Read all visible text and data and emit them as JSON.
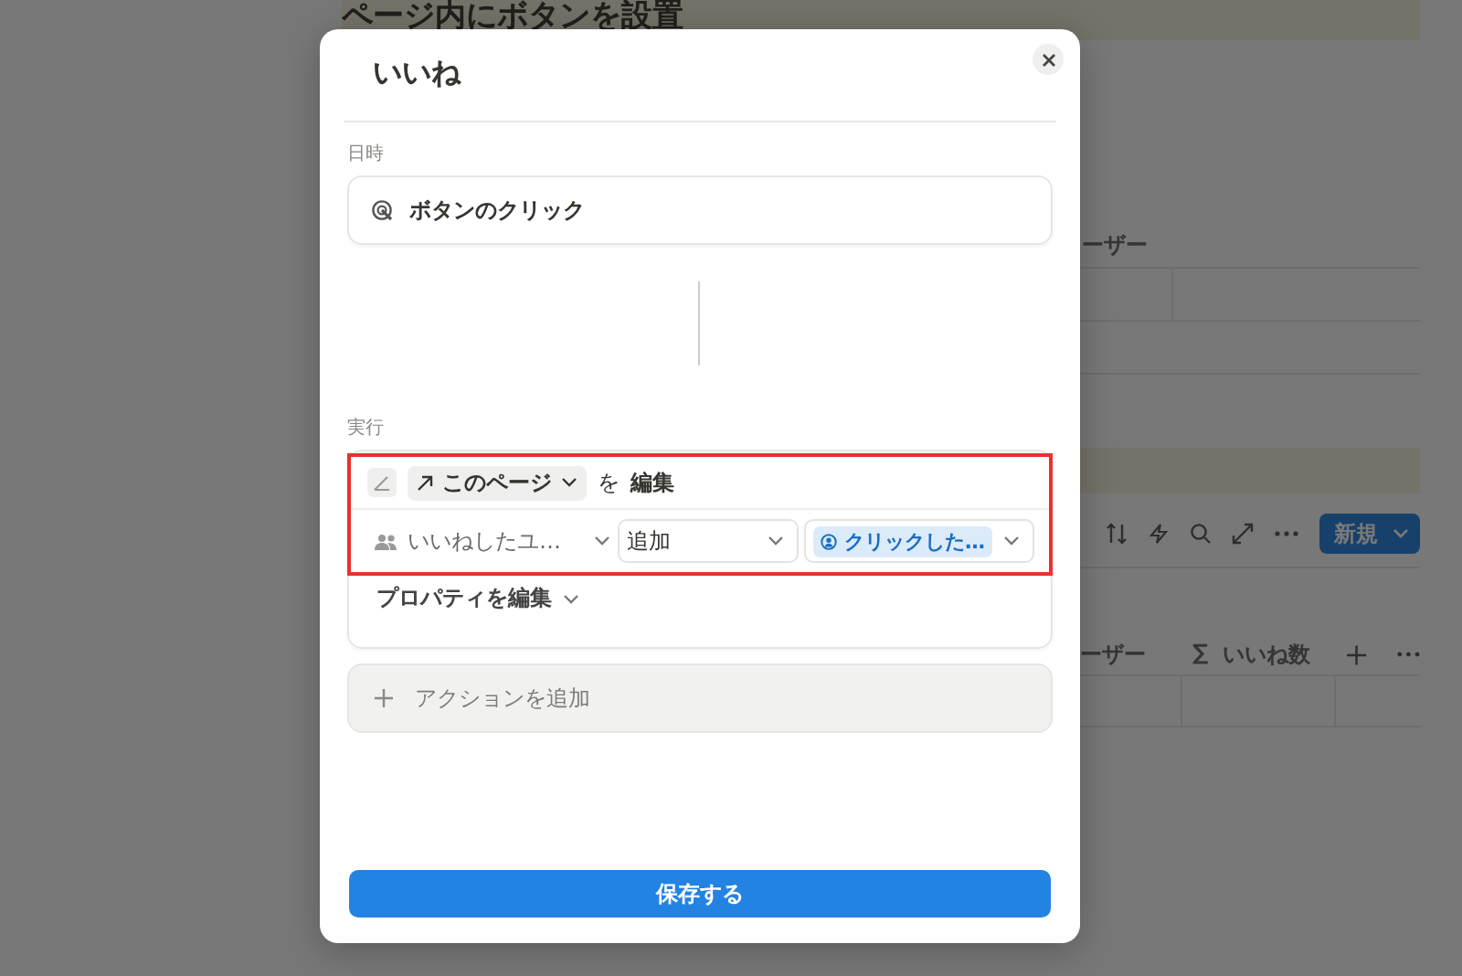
{
  "background_page": {
    "heading": "ページ内にボタンを設置",
    "table_1": {
      "column_header": "ーザー"
    },
    "toolbar": {
      "new_button": "新規"
    },
    "table_2": {
      "columns": [
        {
          "kind": "text",
          "label": "ーザー"
        },
        {
          "kind": "sum",
          "symbol": "∑",
          "label": "いいね数"
        }
      ]
    }
  },
  "dialog": {
    "title": "いいね",
    "trigger": {
      "label": "日時",
      "value": "ボタンのクリック"
    },
    "actions_label": "実行",
    "action": {
      "highlighted": true,
      "target": "このページ",
      "particle": "を",
      "verb": "編集",
      "property": {
        "name": "いいねしたユ…",
        "operation": "追加",
        "value": "クリックした…"
      },
      "edit_properties": "プロパティを編集"
    },
    "add_action": "アクションを追加",
    "save_button": "保存する"
  }
}
